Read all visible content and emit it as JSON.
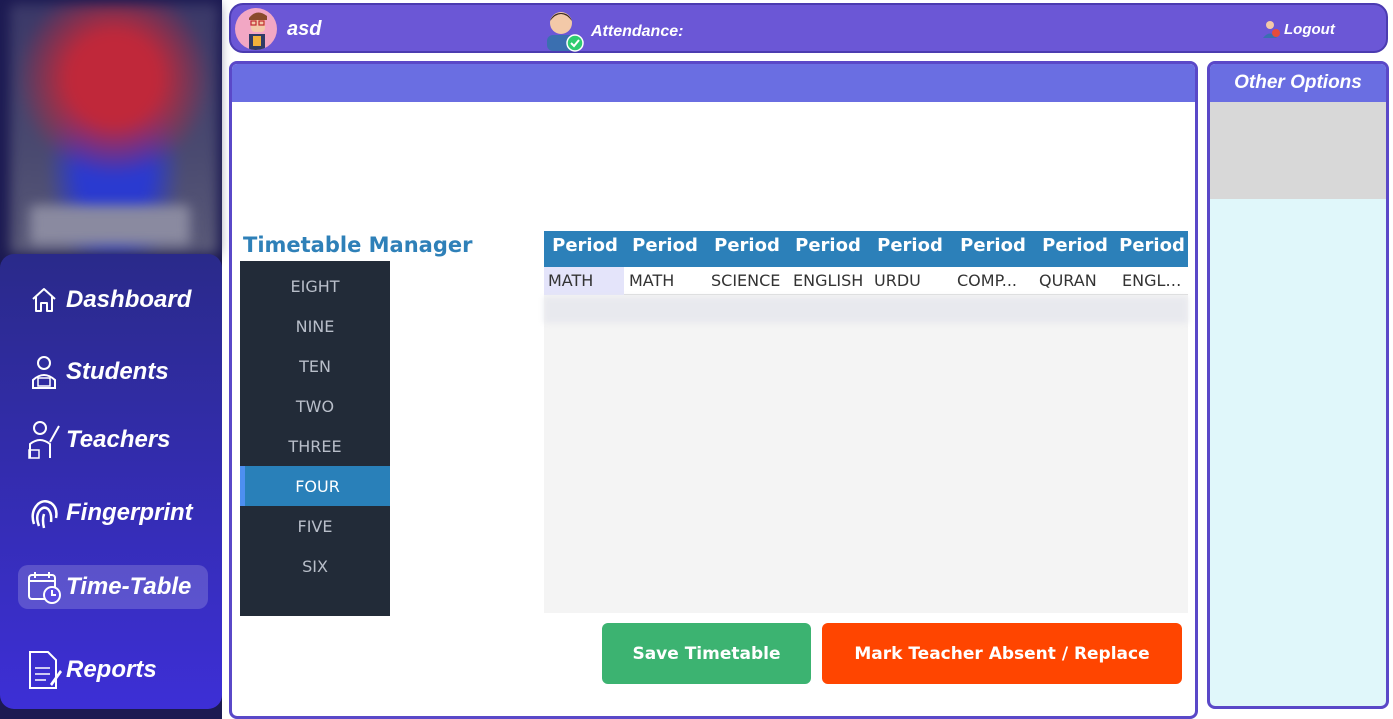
{
  "sidebar": {
    "items": [
      {
        "label": "Dashboard",
        "icon": "home-icon"
      },
      {
        "label": "Students",
        "icon": "student-icon"
      },
      {
        "label": "Teachers",
        "icon": "teacher-icon"
      },
      {
        "label": "Fingerprint",
        "icon": "fingerprint-icon"
      },
      {
        "label": "Time-Table",
        "icon": "calendar-clock-icon",
        "active": true
      },
      {
        "label": "Reports",
        "icon": "report-icon"
      }
    ]
  },
  "topbar": {
    "username": "asd",
    "attendance_label": "Attendance:",
    "logout_label": "Logout"
  },
  "timetable": {
    "title": "Timetable Manager",
    "classes": [
      "EIGHT",
      "NINE",
      "TEN",
      "TWO",
      "THREE",
      "FOUR",
      "FIVE",
      "SIX"
    ],
    "selected_class": "FOUR",
    "headers": [
      "Period",
      "Period",
      "Period",
      "Period",
      "Period",
      "Period",
      "Period",
      "Period"
    ],
    "row": [
      "MATH",
      "MATH",
      "SCIENCE",
      "ENGLISH",
      "URDU",
      "COMP...",
      "QURAN",
      "ENGLI..."
    ]
  },
  "buttons": {
    "save": "Save Timetable",
    "absent": "Mark Teacher Absent / Replace"
  },
  "right_panel": {
    "title": "Other Options"
  },
  "colors": {
    "topbar": "#6b57d6",
    "sidebar_menu": "#3d2fd6",
    "header_blue": "#2c80b9",
    "save_green": "#3cb371",
    "absent_orange": "#ff4500",
    "right_panel_bg": "#e0f7fa"
  }
}
